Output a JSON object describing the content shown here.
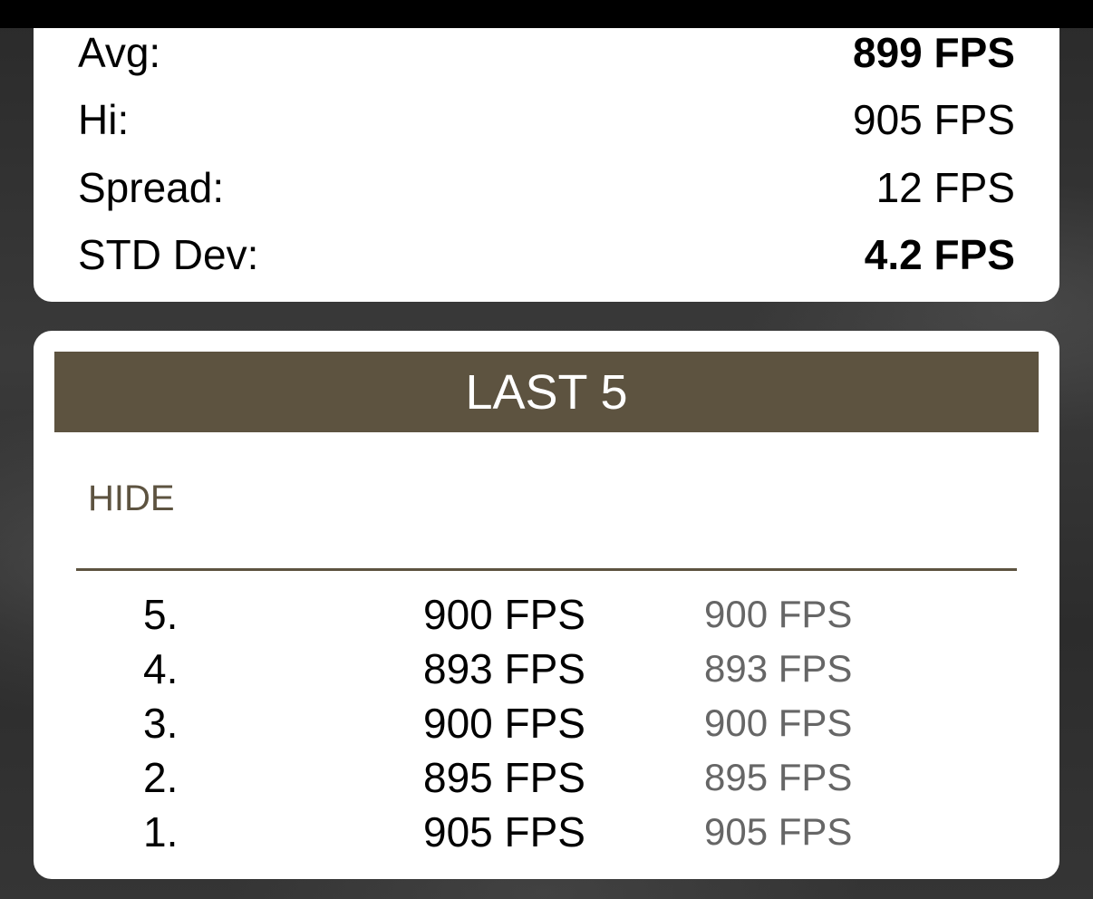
{
  "stats": [
    {
      "label": "Avg:",
      "value": "899 FPS",
      "bold": true
    },
    {
      "label": "Hi:",
      "value": "905 FPS",
      "bold": false
    },
    {
      "label": "Spread:",
      "value": "12 FPS",
      "bold": false
    },
    {
      "label": "STD Dev:",
      "value": "4.2 FPS",
      "bold": true
    }
  ],
  "last5": {
    "title": "LAST 5",
    "hide_label": "HIDE",
    "shots": [
      {
        "num": "5.",
        "value": "900 FPS",
        "alt": "900 FPS"
      },
      {
        "num": "4.",
        "value": "893 FPS",
        "alt": "893 FPS"
      },
      {
        "num": "3.",
        "value": "900 FPS",
        "alt": "900 FPS"
      },
      {
        "num": "2.",
        "value": "895 FPS",
        "alt": "895 FPS"
      },
      {
        "num": "1.",
        "value": "905 FPS",
        "alt": "905 FPS"
      }
    ]
  },
  "colors": {
    "accent": "#5d5340",
    "secondary_text": "#666666"
  }
}
